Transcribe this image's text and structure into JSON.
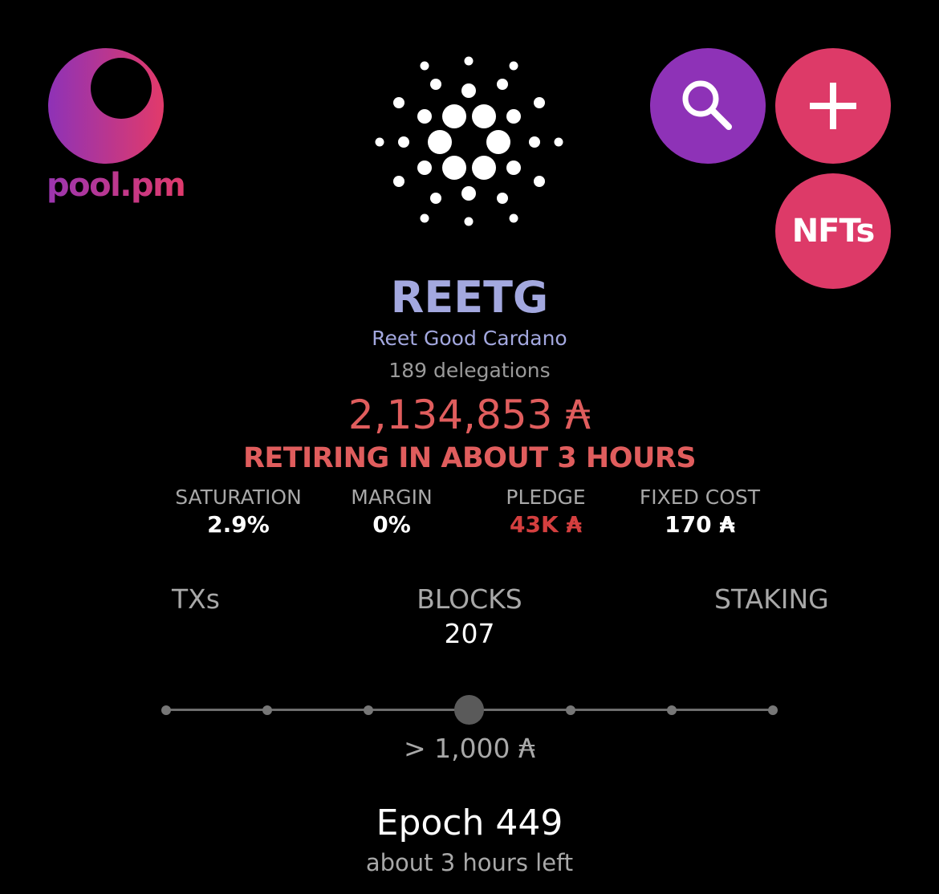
{
  "logo": {
    "text": "pool.pm"
  },
  "header": {
    "nfts_label": "NFTs",
    "search_icon": "search-icon",
    "add_icon": "plus-icon",
    "center_icon": "cardano-logo"
  },
  "pool": {
    "ticker": "REETG",
    "name": "Reet Good Cardano",
    "delegations": "189 delegations",
    "stake": "2,134,853 ₳",
    "status": "RETIRING IN ABOUT 3 HOURS"
  },
  "stats": [
    {
      "label": "SATURATION",
      "value": "2.9%"
    },
    {
      "label": "MARGIN",
      "value": "0%"
    },
    {
      "label": "PLEDGE",
      "value": "43K ₳"
    },
    {
      "label": "FIXED COST",
      "value": "170 ₳"
    }
  ],
  "tabs": {
    "txs": "TXs",
    "blocks": "BLOCKS",
    "blocks_count": "207",
    "staking": "STAKING"
  },
  "slider": {
    "value_label": "> 1,000 ₳",
    "steps": 7,
    "selected_step": 4
  },
  "epoch": {
    "title": "Epoch 449",
    "remaining": "about 3 hours left"
  },
  "colors": {
    "purple": "#8e32b7",
    "pink": "#dd3a68",
    "ticker": "#a3a8df",
    "alert_red": "#e05d5d",
    "pledge_red": "#d43f3f"
  }
}
